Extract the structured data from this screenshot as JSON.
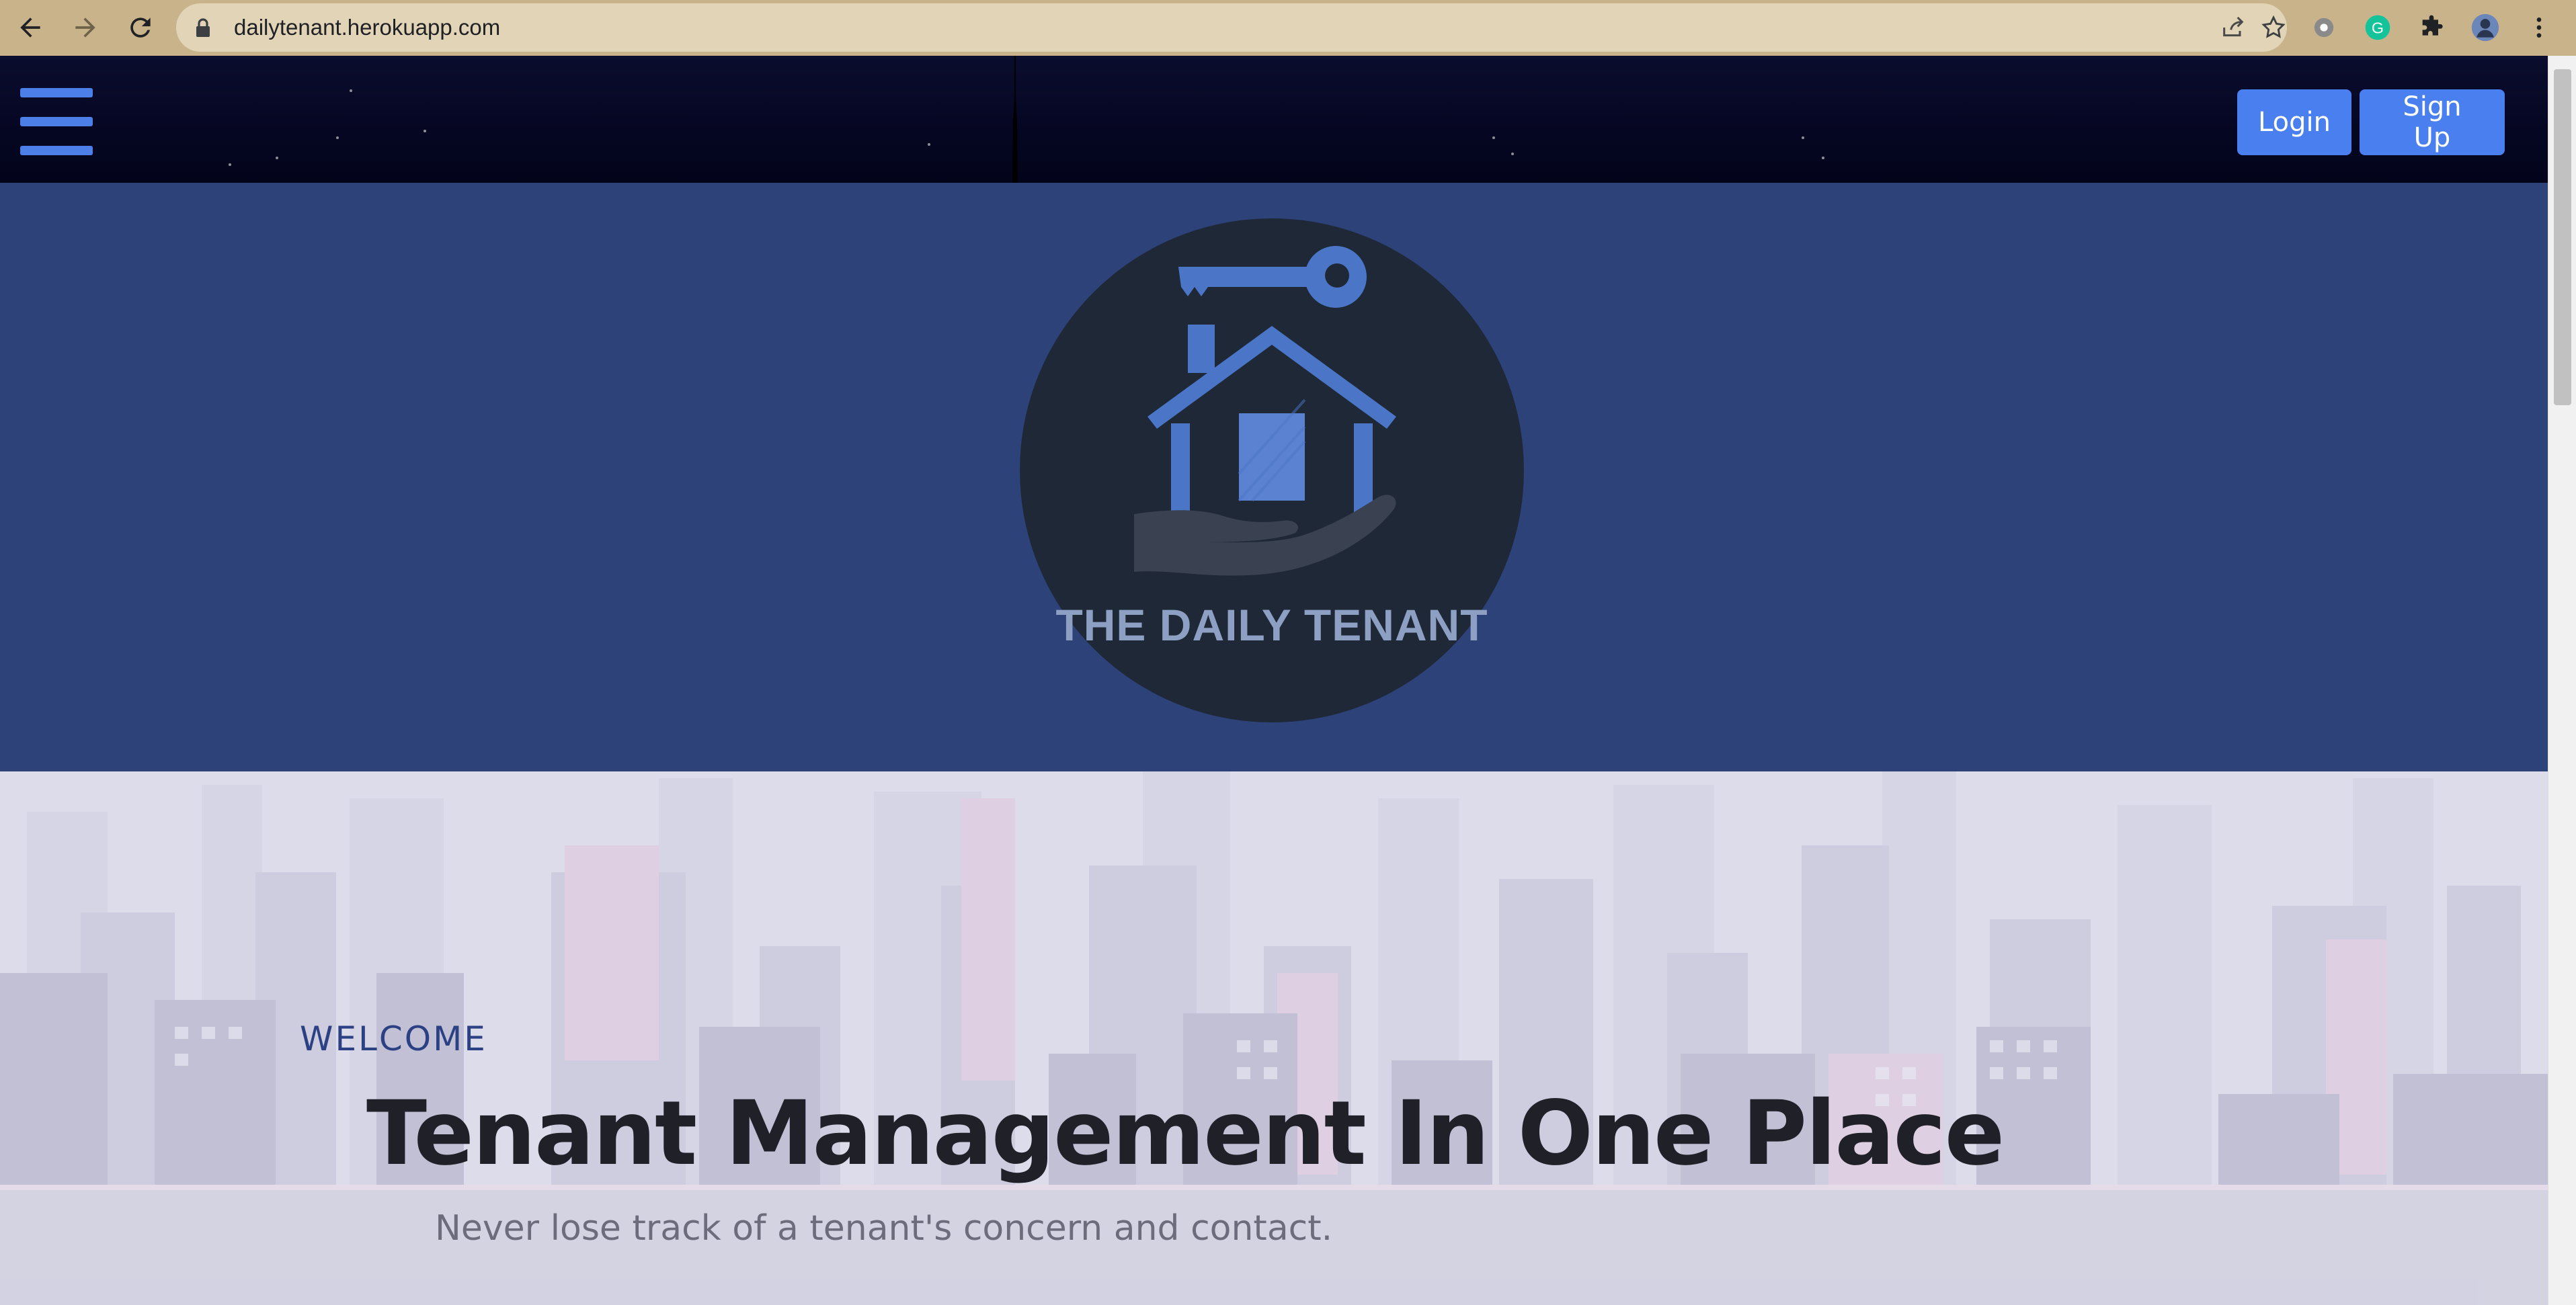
{
  "browser": {
    "url": "dailytenant.herokuapp.com",
    "icons": [
      "back-arrow-icon",
      "forward-arrow-icon",
      "reload-icon",
      "lock-icon",
      "share-icon",
      "star-icon",
      "extension-circle-icon",
      "grammarly-icon",
      "puzzle-icon",
      "profile-avatar-icon",
      "kebab-menu-icon"
    ]
  },
  "header": {
    "menu_icon": "hamburger-icon",
    "login_label": "Login",
    "signup_label": "Sign Up",
    "button_color": "#4a7fef"
  },
  "logo": {
    "text": "THE DAILY TENANT",
    "band_color": "#2e427a",
    "circle_color": "#1e2836",
    "mark_color": "#4b76c8"
  },
  "hero": {
    "eyebrow": "WELCOME",
    "title": "Tenant Management In One Place",
    "subtitle": "Never lose track of a tenant's concern and contact."
  }
}
